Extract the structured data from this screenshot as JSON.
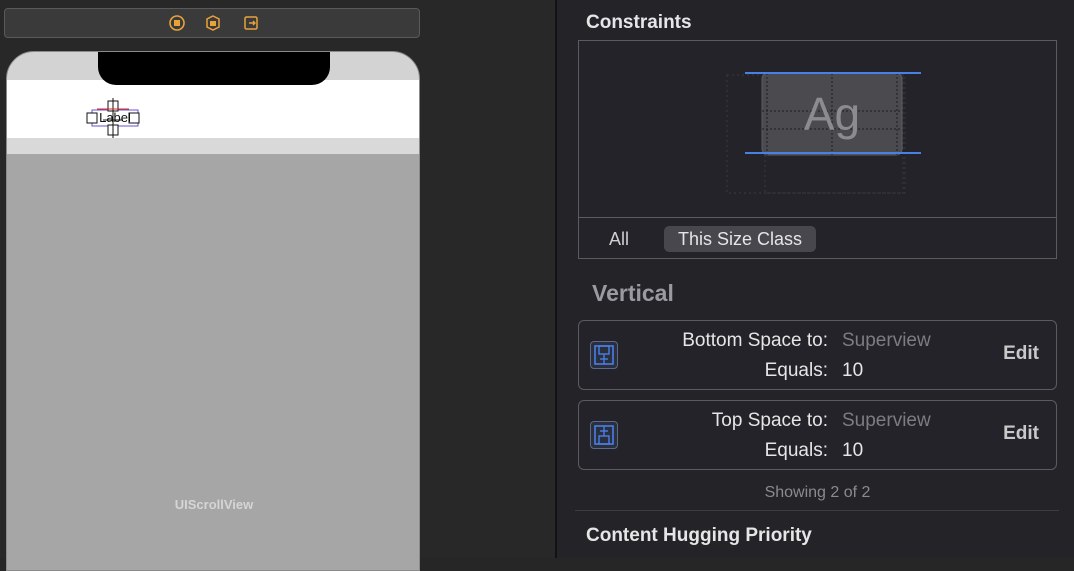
{
  "canvas": {
    "scene_bar_icons": [
      "view-controller-icon",
      "first-responder-icon",
      "exit-icon"
    ],
    "label_text": "Label",
    "scroll_view_label": "UIScrollView"
  },
  "inspector": {
    "constraints_title": "Constraints",
    "preview_text": "Ag",
    "tabs": [
      {
        "label": "All",
        "selected": false
      },
      {
        "label": "This Size Class",
        "selected": true
      }
    ],
    "vertical_title": "Vertical",
    "constraints": [
      {
        "icon": "bottom-space-icon",
        "key": "Bottom Space to:",
        "target": "Superview",
        "equals_label": "Equals:",
        "equals_value": "10",
        "edit_label": "Edit"
      },
      {
        "icon": "top-space-icon",
        "key": "Top Space to:",
        "target": "Superview",
        "equals_label": "Equals:",
        "equals_value": "10",
        "edit_label": "Edit"
      }
    ],
    "showing_text": "Showing 2 of 2",
    "content_hugging_title": "Content Hugging Priority"
  },
  "colors": {
    "accent_blue": "#4a7fe6",
    "icon_orange": "#e8a23a"
  }
}
